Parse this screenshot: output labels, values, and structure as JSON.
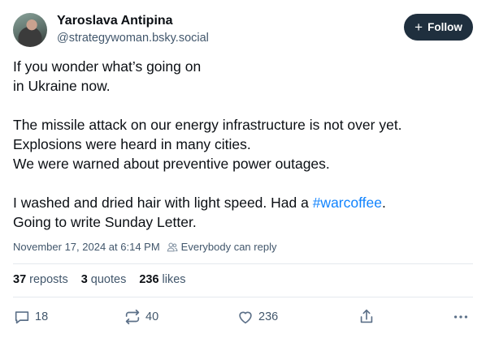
{
  "author": {
    "display_name": "Yaroslava Antipina",
    "handle": "@strategywoman.bsky.social"
  },
  "follow_button": {
    "label": "Follow",
    "icon": "plus-icon"
  },
  "post": {
    "lines": [
      "If you wonder what’s going on",
      "in Ukraine now.",
      "",
      "The missile attack on our energy infrastructure is not over yet.",
      "Explosions were heard in many cities.",
      "We were warned about preventive power outages.",
      "",
      "I washed and dried hair with light speed. Had a ",
      "Going to write Sunday Letter."
    ],
    "hashtag": "#warcoffee",
    "hashtag_suffix": "."
  },
  "meta": {
    "timestamp": "November 17, 2024 at 6:14 PM",
    "reply_setting": "Everybody can reply"
  },
  "stats": {
    "reposts_count": "37",
    "reposts_label": "reposts",
    "quotes_count": "3",
    "quotes_label": "quotes",
    "likes_count": "236",
    "likes_label": "likes"
  },
  "actions": {
    "reply_count": "18",
    "repost_count": "40",
    "like_count": "236"
  },
  "colors": {
    "link": "#1083fe",
    "follow_bg": "#1f2f3e",
    "muted_text": "#42576c"
  }
}
